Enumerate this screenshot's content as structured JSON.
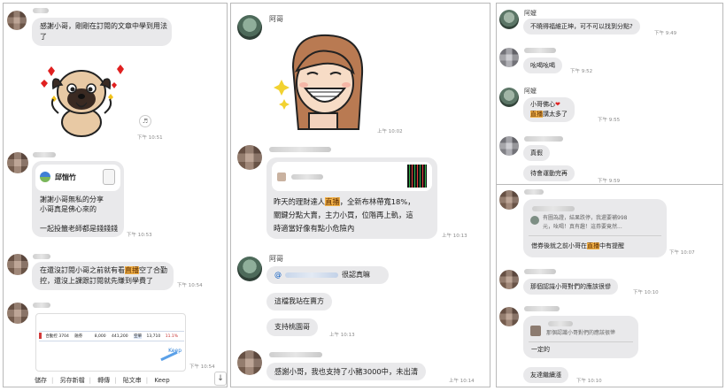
{
  "p1": {
    "msg1": {
      "l1": "感謝小哥，剛剛在訂閱的文章中學到用法",
      "l2": "了"
    },
    "time1": "下午 10:51",
    "card_name": "邱愷竹",
    "card": {
      "l1": "謝謝小哥無私的分享",
      "l2": "小哥真是佛心來的",
      "l3": "一起投籤老師都是錢錢錢"
    },
    "time2": "下午 10:53",
    "msg3": {
      "a": "在還沒訂閱小哥之前就有看",
      "hl": "直播",
      "b": "空了合勤",
      "l2": "控，還沒上課跟訂閱就先賺到學費了"
    },
    "time3": "下午 10:54",
    "quote_row": [
      "合勤控 3704",
      "融券",
      "8,000",
      "441,200",
      "空單",
      "13,710",
      "11.1%"
    ],
    "keep_label": "Keep",
    "time4": "下午 10:54",
    "toolbar": [
      "儲存",
      "另存新檔",
      "轉傳",
      "貼文串",
      "Keep"
    ],
    "scroll_arrow": "↓"
  },
  "p2": {
    "name1": "阿哥",
    "time1": "上午 10:02",
    "msg2": {
      "l1a": "昨天的理財達人",
      "l1hl": "直播",
      "l1b": "，全新布林帶寬18%，",
      "l2": "關鍵分點大賣，主力小買，位階再上軌，這",
      "l3": "時適當好像有點小危險內"
    },
    "time2": "上午 10:13",
    "name3": "阿哥",
    "mention_at": "@",
    "mention_tail": "很認真嘛",
    "msg4": "這檔我站在賣方",
    "msg5": "支持桃園哥",
    "time3": "上午 10:13",
    "msg6": "感謝小哥，我也支持了小豬3000中，未出清",
    "time4": "上午 10:14"
  },
  "p3": {
    "name1": "阿嬤",
    "msg1": "不曉得福維正坤，可不可以找到分點?",
    "time1": "下午 9:49",
    "msg2": "吆喝吆喝",
    "time2": "下午 9:52",
    "name3": "阿嬤",
    "msg3": {
      "l1": "小哥佛心",
      "heart": "❤",
      "l2hl": "直播",
      "l2": "講太多了"
    },
    "time3": "下午 9:55",
    "msg4": "真假",
    "msg5": "待會運動完再",
    "time5": "下午 9:59"
  },
  "p4": {
    "reply": {
      "l1": "有圖為證，結果跌停，我還要補998",
      "l2": "元，吆喝！真有趣！這券要竟然..."
    },
    "msg1": {
      "a": "借券後就之前小哥在",
      "hl": "直播",
      "b": "中有提醒"
    },
    "time1": "下午 10:07",
    "msg2": "那個認識小哥對們的應該很慘",
    "time2": "下午 10:10",
    "reply2": "那個認識小哥對們的應該很慘",
    "msg3a": "一定的",
    "msg3b": "友達繼續漲",
    "time3": "下午 10:10"
  },
  "colors": {
    "bubble": "#e9e9eb",
    "highlight": "#f6b54a",
    "heart": "#e02020"
  }
}
